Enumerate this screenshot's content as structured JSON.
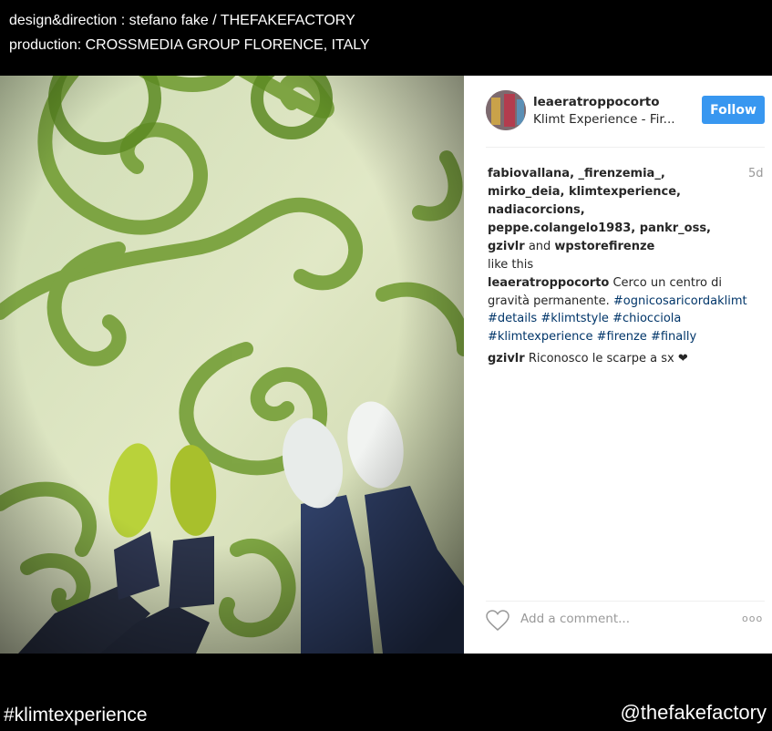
{
  "credits": {
    "line1": "design&direction : stefano fake / THEFAKEFACTORY",
    "line2": "production: CROSSMEDIA GROUP FLORENCE, ITALY"
  },
  "post": {
    "username": "leaeratroppocorto",
    "location": "Klimt Experience - Fir...",
    "follow_label": "Follow",
    "time": "5d",
    "likes": {
      "names": "fabiovallana, _firenzemia_, mirko_deia, klimtexperience, nadiacorcions, peppe.colangelo1983, pankr_oss, gzivlr",
      "and": "and",
      "last": "wpstorefirenze",
      "suffix": "like this"
    },
    "caption": {
      "user": "leaeratroppocorto",
      "text": "Cerco un centro di gravità permanente.",
      "tags": [
        "#ognicosaricordaklimt",
        "#details",
        "#klimtstyle",
        "#chiocciola",
        "#klimtexperience",
        "#firenze",
        "#finally"
      ]
    },
    "comment": {
      "user": "gzivlr",
      "text": "Riconosco le scarpe a sx",
      "emoji": "❤"
    },
    "add_comment_placeholder": "Add a comment...",
    "more_label": "ooo"
  },
  "footer": {
    "hashtag": "#klimtexperience",
    "handle": "@thefakefactory"
  },
  "colors": {
    "follow_button": "#3897f0",
    "hashtag_link": "#003569",
    "carpet_bg": "#d9e3bf",
    "spiral": "#6e9a2e"
  }
}
